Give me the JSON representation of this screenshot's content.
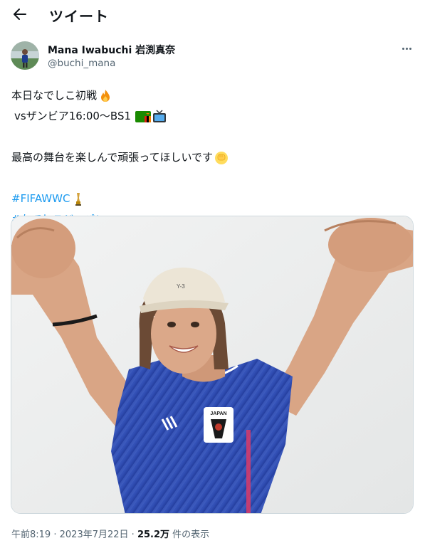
{
  "header": {
    "back_icon": "arrow-left-icon",
    "title": "ツイート"
  },
  "author": {
    "display_name": "Mana Iwabuchi 岩渕真奈",
    "handle": "@buchi_mana"
  },
  "tweet": {
    "line1": "本日なでしこ初戦",
    "line2": "vsザンビア16:00〜BS1",
    "line3": "最高の舞台を楽しんで頑張ってほしいです",
    "hashtag1": "#FIFAWWC",
    "hashtag2": "#なでしこジャパン",
    "emojis": [
      "fire-icon",
      "zambia-flag-icon",
      "tv-icon",
      "raised-fist-icon",
      "trophy-icon"
    ]
  },
  "media": {
    "cap_logo": "Y-3",
    "crest_text": "JAPAN"
  },
  "meta": {
    "time": "午前8:19",
    "separator": "·",
    "date": "2023年7月22日",
    "views_count": "25.2万",
    "views_label": "件の表示"
  },
  "colors": {
    "link": "#1d9bf0",
    "secondary_text": "#536471",
    "primary_text": "#0f1419"
  }
}
